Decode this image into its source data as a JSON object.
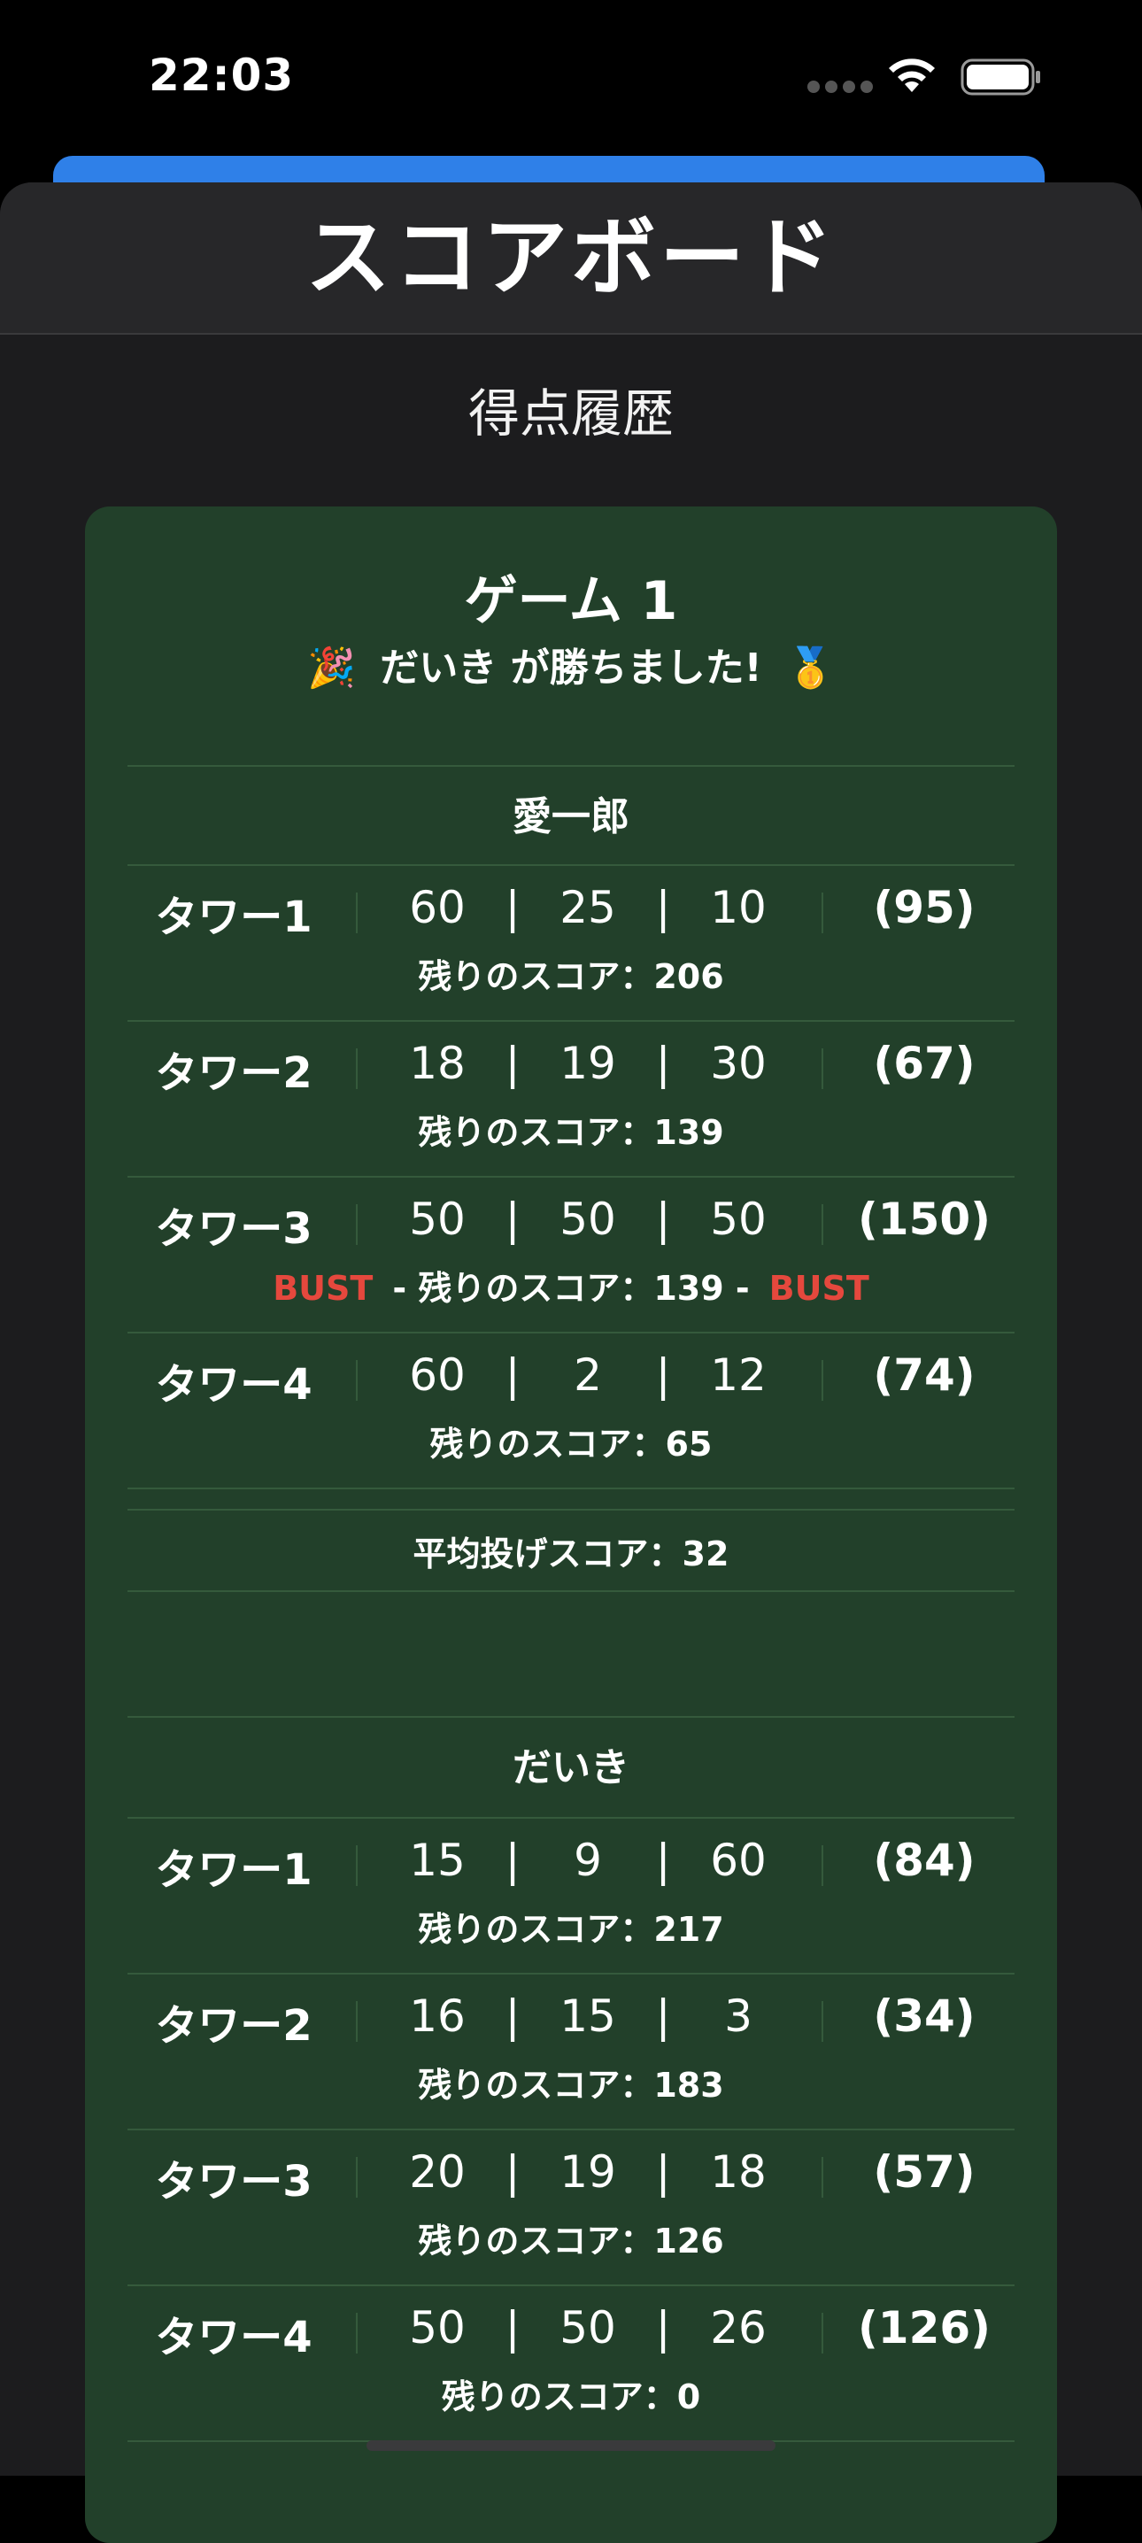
{
  "status": {
    "time": "22:03"
  },
  "header": {
    "title": "スコアボード"
  },
  "history": {
    "title": "得点履歴"
  },
  "game": {
    "title": "ゲーム 1",
    "party_emoji": "🎉",
    "winner_text": "だいき が勝ちました!",
    "medal_emoji": "🥇",
    "players": [
      {
        "name": "愛一郎",
        "towers": [
          {
            "label": "タワー1",
            "s1": "60",
            "s2": "25",
            "s3": "10",
            "total": "(95)",
            "remaining": "残りのスコア：206"
          },
          {
            "label": "タワー2",
            "s1": "18",
            "s2": "19",
            "s3": "30",
            "total": "(67)",
            "remaining": "残りのスコア：139"
          },
          {
            "label": "タワー3",
            "s1": "50",
            "s2": "50",
            "s3": "50",
            "total": "(150)",
            "remaining": "- 残りのスコア：139 -",
            "bust_left": "BUST",
            "bust_right": "BUST"
          },
          {
            "label": "タワー4",
            "s1": "60",
            "s2": "2",
            "s3": "12",
            "total": "(74)",
            "remaining": "残りのスコア：65"
          }
        ],
        "average": "平均投げスコア：32"
      },
      {
        "name": "だいき",
        "towers": [
          {
            "label": "タワー1",
            "s1": "15",
            "s2": "9",
            "s3": "60",
            "total": "(84)",
            "remaining": "残りのスコア：217"
          },
          {
            "label": "タワー2",
            "s1": "16",
            "s2": "15",
            "s3": "3",
            "total": "(34)",
            "remaining": "残りのスコア：183"
          },
          {
            "label": "タワー3",
            "s1": "20",
            "s2": "19",
            "s3": "18",
            "total": "(57)",
            "remaining": "残りのスコア：126"
          },
          {
            "label": "タワー4",
            "s1": "50",
            "s2": "50",
            "s3": "26",
            "total": "(126)",
            "remaining": "残りのスコア：0"
          }
        ]
      }
    ]
  },
  "colors": {
    "card": "#22402a",
    "sheet": "#1c1c1e",
    "accent": "#2f80e8",
    "bust": "#e5483d"
  }
}
